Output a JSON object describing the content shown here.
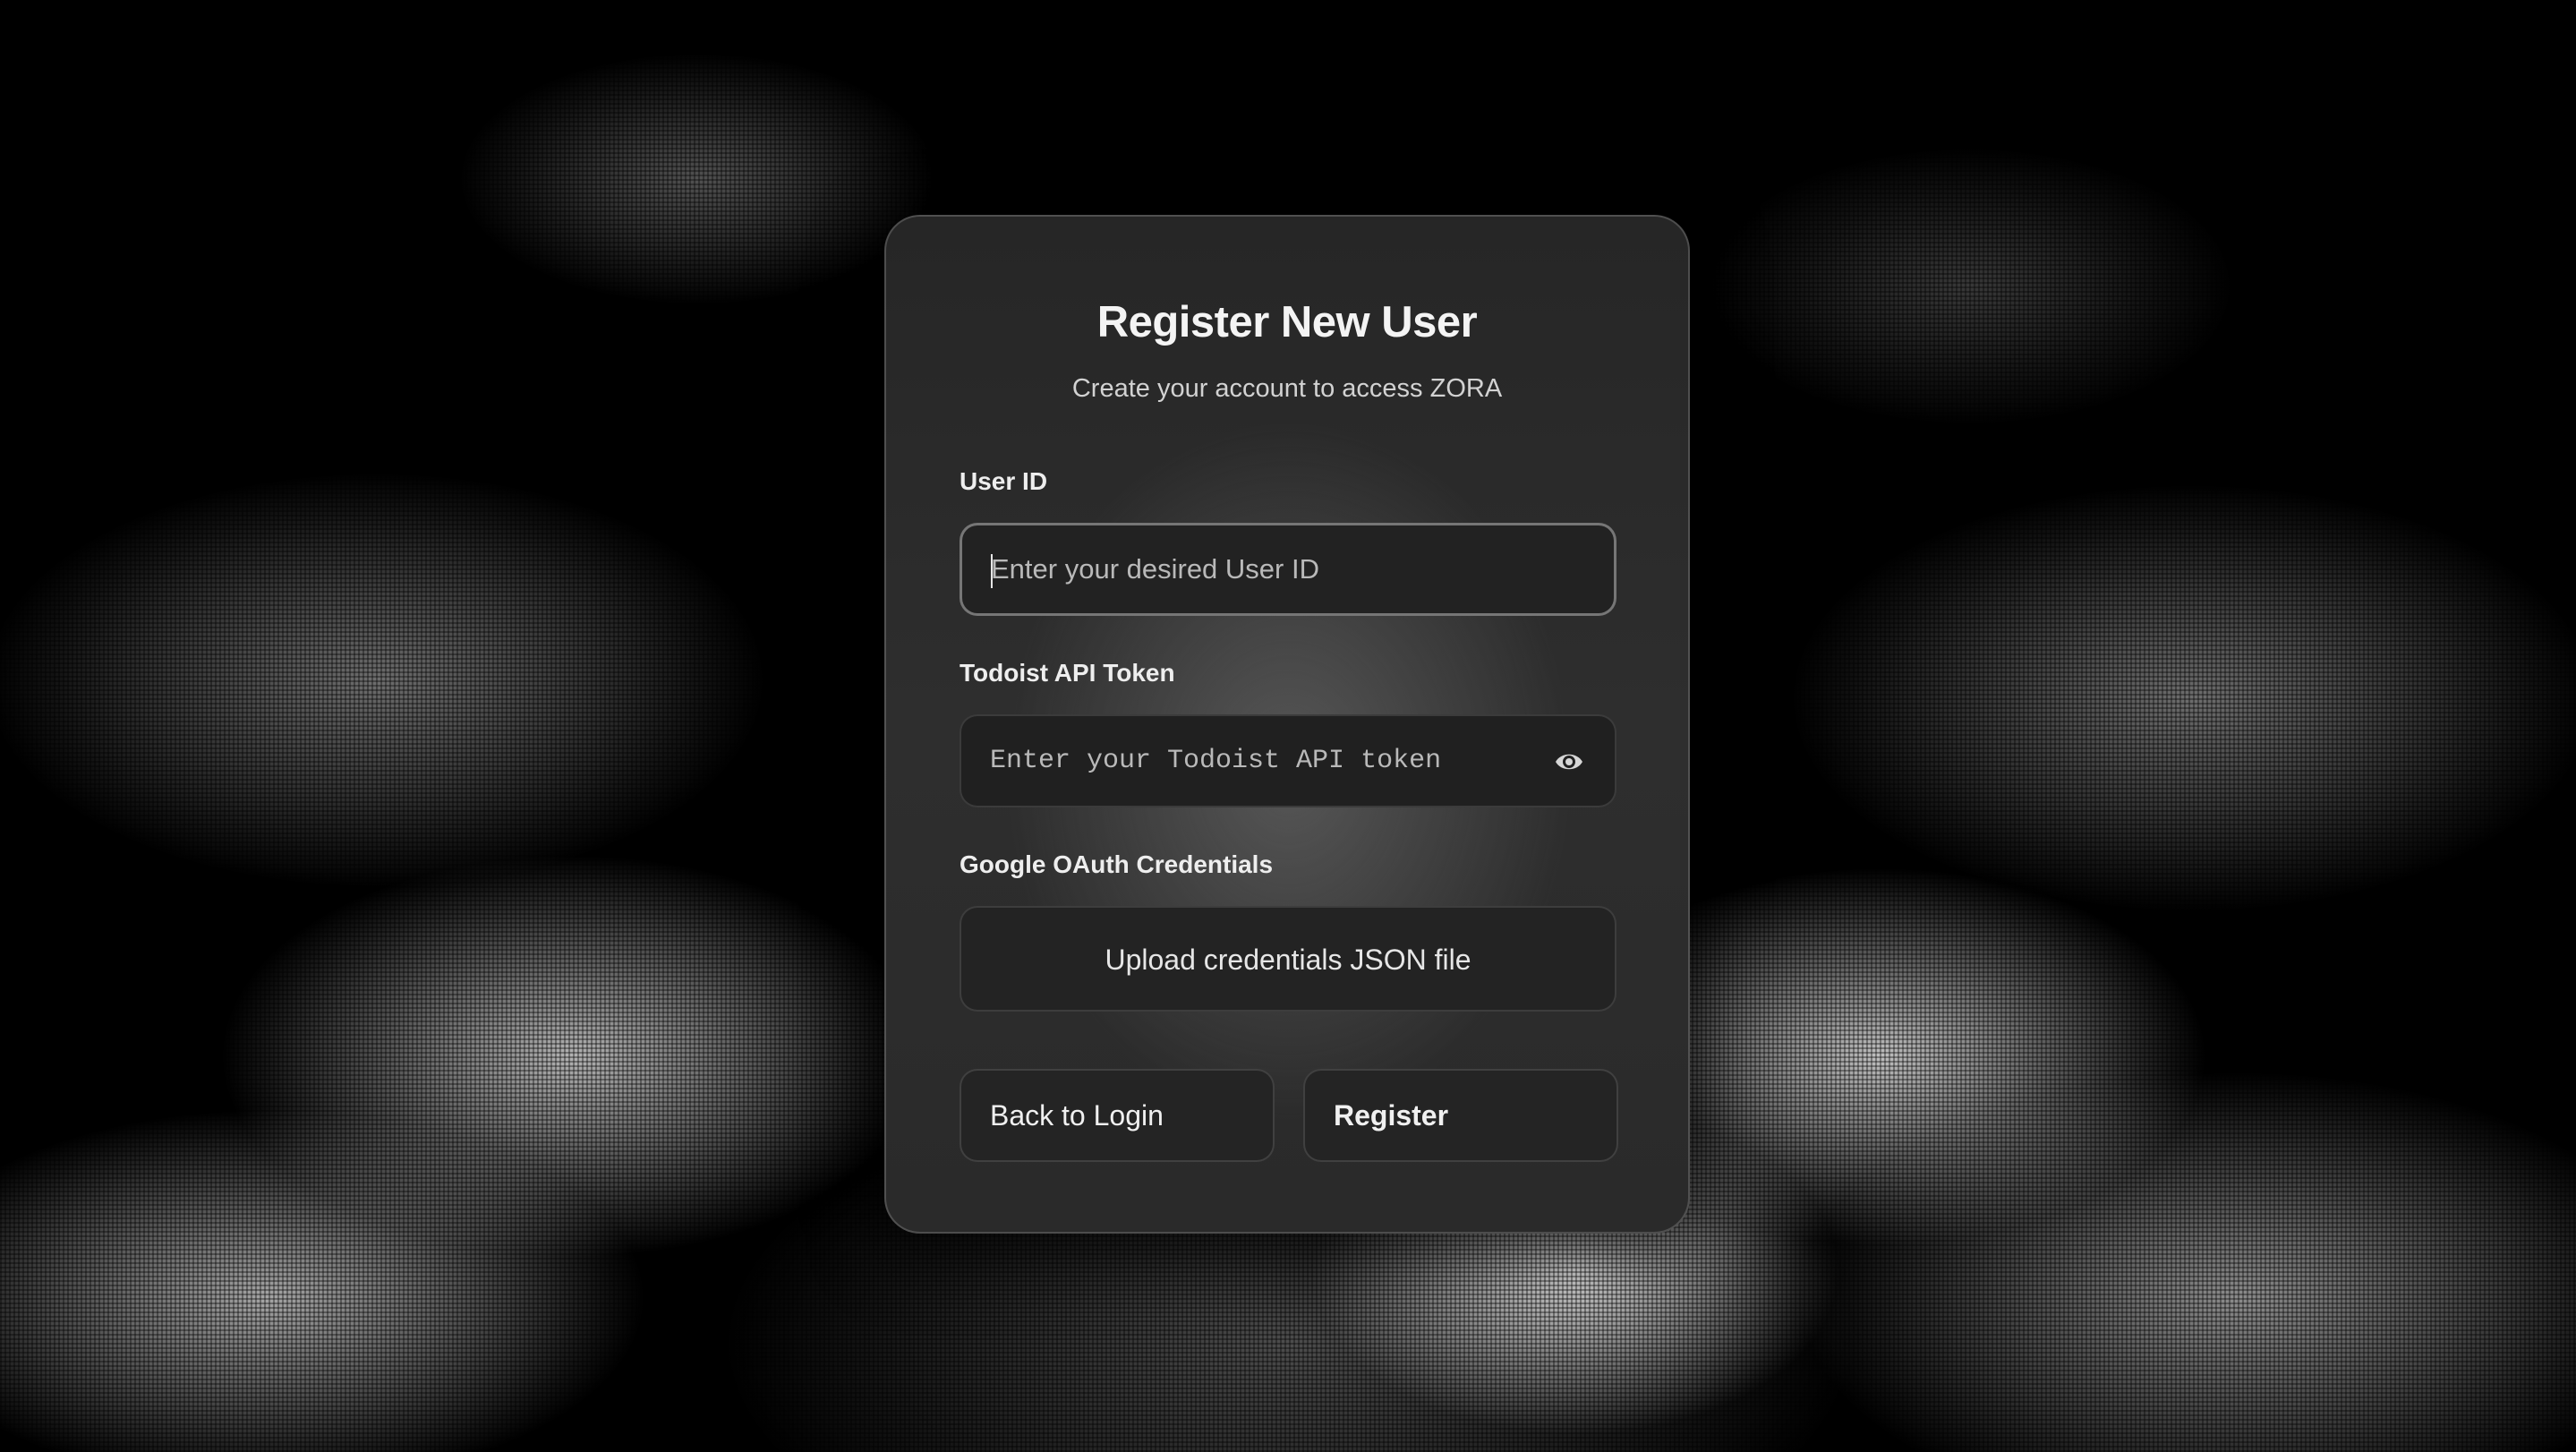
{
  "form": {
    "title": "Register New User",
    "subtitle": "Create your account to access ZORA",
    "user_id": {
      "label": "User ID",
      "placeholder": "Enter your desired User ID",
      "value": ""
    },
    "todoist_token": {
      "label": "Todoist API Token",
      "placeholder": "Enter your Todoist API token",
      "value": "",
      "toggle_icon": "eye-icon"
    },
    "google_oauth": {
      "label": "Google OAuth Credentials",
      "upload_label": "Upload credentials JSON file"
    },
    "buttons": {
      "back_label": "Back to Login",
      "register_label": "Register"
    }
  },
  "colors": {
    "card_background": "#2a2a2a",
    "page_background": "#000000",
    "text_primary": "#f4f4f4",
    "text_secondary": "#d2d2d2",
    "input_background": "#202020"
  }
}
